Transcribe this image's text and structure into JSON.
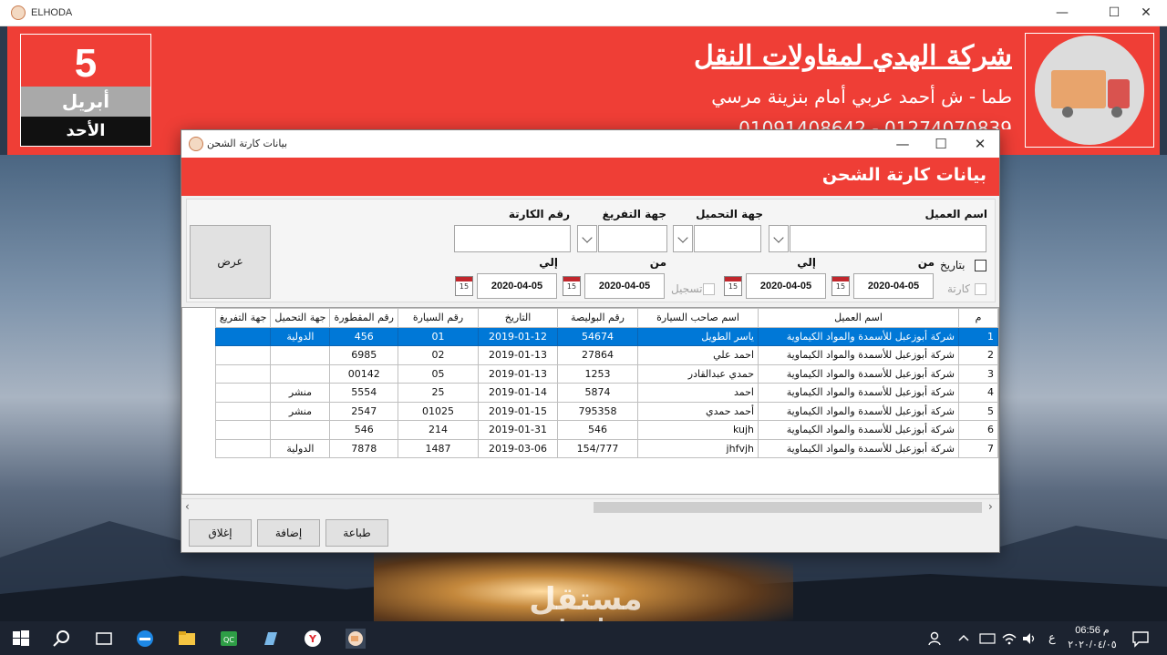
{
  "app": {
    "title": "ELHODA",
    "min": "—",
    "max": "☐",
    "close": "✕"
  },
  "header": {
    "date_day": "5",
    "date_month": "أبريل",
    "date_weekday": "الأحد",
    "company_name": "شركة الهدي لمقاولات النقل",
    "address": "طما - ش أحمد عربي أمام بنزينة مرسي",
    "phones": "01091408642 - 01274070839"
  },
  "dialog": {
    "title": "بيانات كارتة الشحن",
    "banner_title": "بيانات كارتة الشحن",
    "min": "—",
    "max": "☐",
    "close": "✕"
  },
  "filters": {
    "customer_label": "اسم العميل",
    "loading_label": "جهة التحميل",
    "unloading_label": "جهة التفريغ",
    "card_no_label": "رقم الكارتة",
    "customer_value": "",
    "loading_value": "",
    "unloading_value": "",
    "card_no_value": "",
    "by_date_label": "بتاريخ",
    "card_label": "كارتة",
    "register_label": "تسجيل",
    "from_label_1": "من",
    "to_label_1": "إلي",
    "from_label_2": "من",
    "to_label_2": "إلي",
    "date_from_1": "2020-04-05",
    "date_to_1": "2020-04-05",
    "date_from_2": "2020-04-05",
    "date_to_2": "2020-04-05",
    "calendar_glyph": "15",
    "show_button": "عرض"
  },
  "grid": {
    "columns": [
      "م",
      "اسم العميل",
      "اسم صاحب السيارة",
      "رقم البوليصة",
      "التاريخ",
      "رقم السيارة",
      "رقم المقطورة",
      "جهة التحميل",
      "جهة التفريغ"
    ],
    "rows": [
      [
        "1",
        "شركة أبوزعبل للأسمدة والمواد الكيماوية",
        "ياسر الطويل",
        "54674",
        "2019-01-12",
        "01",
        "456",
        "الدولية",
        ""
      ],
      [
        "2",
        "شركة أبوزعبل للأسمدة والمواد الكيماوية",
        "احمد علي",
        "27864",
        "2019-01-13",
        "02",
        "6985",
        "",
        ""
      ],
      [
        "3",
        "شركة أبوزعبل للأسمدة والمواد الكيماوية",
        "حمدي عبدالقادر",
        "1253",
        "2019-01-13",
        "05",
        "00142",
        "",
        ""
      ],
      [
        "4",
        "شركة أبوزعبل للأسمدة والمواد الكيماوية",
        "احمد",
        "5874",
        "2019-01-14",
        "25",
        "5554",
        "منشر",
        ""
      ],
      [
        "5",
        "شركة أبوزعبل للأسمدة والمواد الكيماوية",
        "أحمد حمدي",
        "795358",
        "2019-01-15",
        "01025",
        "2547",
        "منشر",
        ""
      ],
      [
        "6",
        "شركة أبوزعبل للأسمدة والمواد الكيماوية",
        "kujh",
        "546",
        "2019-01-31",
        "214",
        "546",
        "",
        ""
      ],
      [
        "7",
        "شركة أبوزعبل للأسمدة والمواد الكيماوية",
        "jhfvjh",
        "154/777",
        "2019-03-06",
        "1487",
        "7878",
        "الدولية",
        ""
      ]
    ],
    "selected_row": 0
  },
  "buttons": {
    "print": "طباعة",
    "add": "إضافة",
    "close": "إغلاق"
  },
  "watermark": {
    "arabic": "مستقل",
    "latin": "mostaql.com"
  },
  "taskbar": {
    "time": "06:56 م",
    "date": "٢٠٢٠/٠٤/٠٥",
    "lang": "ع"
  }
}
